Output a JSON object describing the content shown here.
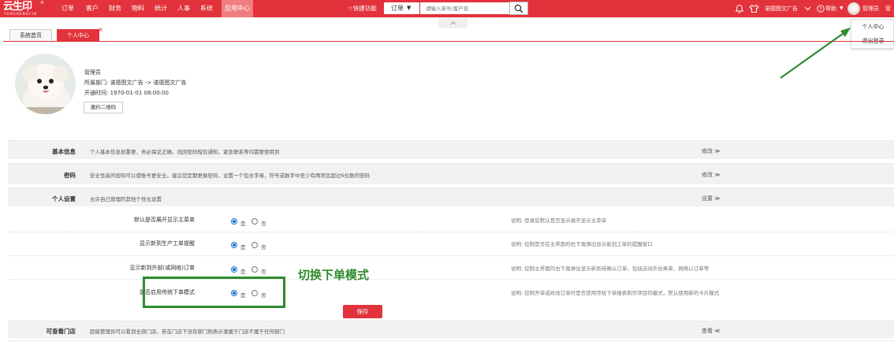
{
  "brand": {
    "logo_main": "云生印",
    "logo_sub": "YUNSHENGYIN",
    "logo_reg": "®"
  },
  "nav": {
    "items": [
      "订单",
      "客户",
      "财务",
      "物料",
      "统计",
      "人事",
      "系统"
    ],
    "active": "应用中心"
  },
  "header": {
    "quick_label": "☆快捷功能",
    "order_select": "订单",
    "search_placeholder": "请输入单号/客户名",
    "company": "诺德图文广告",
    "help": "帮助",
    "user": "管理员",
    "user_tail": "管"
  },
  "dropdown": {
    "items": [
      "个人中心",
      "退出登录"
    ]
  },
  "tabs": [
    {
      "label": "系统首页",
      "active": false
    },
    {
      "label": "个人中心",
      "active": true
    }
  ],
  "tab_close": "×",
  "profile": {
    "name": "管理员",
    "dept_label": "所属部门:",
    "dept_from": "诺德图文广告",
    "dept_arrow": "->",
    "dept_to": "诺德图文广告",
    "open_label": "开通时间:",
    "open_time": "1970-01-01 08:00:00",
    "invite_button": "邀约二维码"
  },
  "sections": {
    "basic": {
      "label": "基本信息",
      "desc": "个人基本信息很重要，务必保证正确，找回密码短信通知，紧急联系等均需要使用到",
      "action": "修改 ≫"
    },
    "password": {
      "label": "密码",
      "desc": "安全性高的密码可以使账号更安全。建议您定期更换密码，设置一个包含字母，符号或数字中至少有两项且超过6位数的密码",
      "action": "修改 ≫"
    },
    "personal": {
      "label": "个人设置",
      "desc": "允许自己管理的其他个性化设置",
      "action": "设置 ≫"
    },
    "stores": {
      "label": "可查看门店",
      "desc": "超级管理员可以看到全部门店，若在门店下没有部门则表示隶属于门店不属于任何部门",
      "action": "查看 ≪"
    }
  },
  "settings": [
    {
      "label": "默认是否展开显示主菜单",
      "yes": "是",
      "no": "否",
      "selected": "是",
      "note": "说明: 登录后默认是否显示展开显示主菜单"
    },
    {
      "label": "显示新到生产工单提醒",
      "yes": "是",
      "no": "否",
      "selected": "是",
      "note": "说明: 控制是否在主界面的右下角弹出显示新到工单的提醒窗口"
    },
    {
      "label": "显示新到外部(或网络)订单",
      "yes": "是",
      "no": "否",
      "selected": "是",
      "note": "说明: 控制主界面的右下角弹出显示新到待确认订单，包括店间外协来单，网络以订单等"
    },
    {
      "label": "是否启用传统下单模式",
      "yes": "是",
      "no": "否",
      "selected": "是",
      "note": "说明: 控制开单或修改订单时是否使用传统下单报表制作项目的模式，默认使用新的卡片模式"
    }
  ],
  "save_button": "保存",
  "annotation": {
    "text": "切换下单模式",
    "color": "#2e8b2e"
  },
  "colors": {
    "brand_red": "#e2323b",
    "active_tab": "#f07d80",
    "radio_blue": "#1a6ed8",
    "annotation_green": "#2e8b2e"
  }
}
